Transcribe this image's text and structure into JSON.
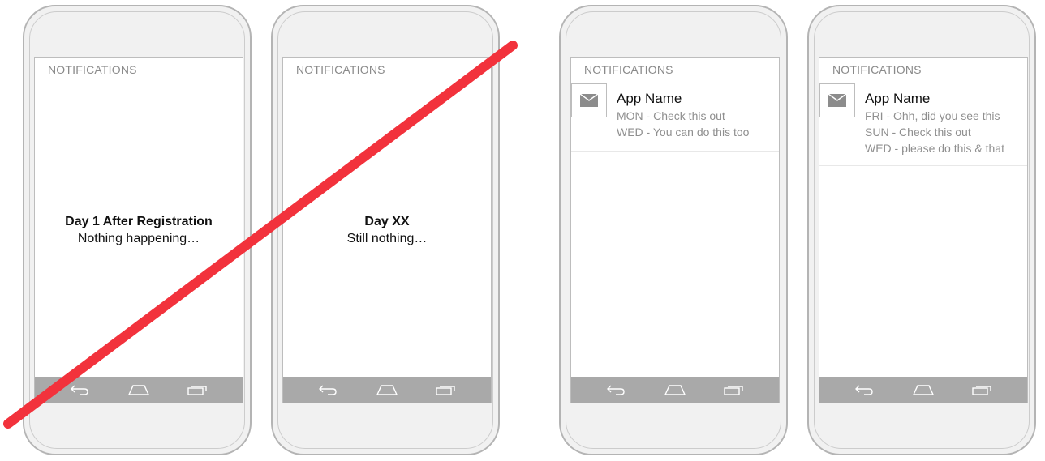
{
  "phones": [
    {
      "header": "NOTIFICATIONS",
      "message_title": "Day 1 After Registration",
      "message_body": "Nothing happening…"
    },
    {
      "header": "NOTIFICATIONS",
      "message_title": "Day XX",
      "message_body": "Still nothing…"
    },
    {
      "header": "NOTIFICATIONS",
      "notification": {
        "app_name": "App Name",
        "lines": [
          "MON - Check this out",
          "WED - You can do this too"
        ]
      }
    },
    {
      "header": "NOTIFICATIONS",
      "notification": {
        "app_name": "App Name",
        "lines": [
          "FRI - Ohh, did you see this",
          "SUN - Check this out",
          "WED - please do this & that"
        ]
      }
    }
  ],
  "nav_icons": [
    "back-icon",
    "home-icon",
    "recent-apps-icon"
  ],
  "icons": {
    "notification": "envelope-icon"
  },
  "colors": {
    "strike_line": "#f2323c",
    "navbar": "#a9a9a9"
  }
}
